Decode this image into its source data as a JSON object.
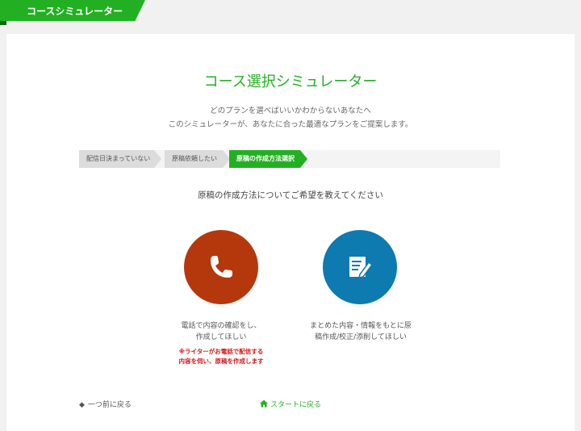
{
  "header": {
    "tab_label": "コースシミュレーター"
  },
  "main": {
    "title": "コース選択シミュレーター",
    "intro_line1": "どのプランを選べばいいかわからないあなたへ",
    "intro_line2": "このシミュレーターが、あなたに合った最適なプランをご提案します。",
    "steps": [
      {
        "label": "配信日決まっていない"
      },
      {
        "label": "原稿依頼したい"
      },
      {
        "label": "原稿の作成方法選択"
      }
    ],
    "question": "原稿の作成方法についてご希望を教えてください",
    "choices": [
      {
        "icon": "phone-icon",
        "color": "#b5380c",
        "line1": "電話で内容の確認をし、",
        "line2": "作成してほしい",
        "note_line1": "※ライターがお電話で配信する",
        "note_line2": "内容を伺い、原稿を作成します"
      },
      {
        "icon": "edit-document-icon",
        "color": "#0d7ab0",
        "line1": "まとめた内容・情報をもとに原",
        "line2": "稿作成/校正/添削してほしい"
      }
    ],
    "back_label": "一つ前に戻る",
    "start_label": "スタートに戻る"
  },
  "colors": {
    "accent": "#22b022",
    "note": "#d01818"
  }
}
